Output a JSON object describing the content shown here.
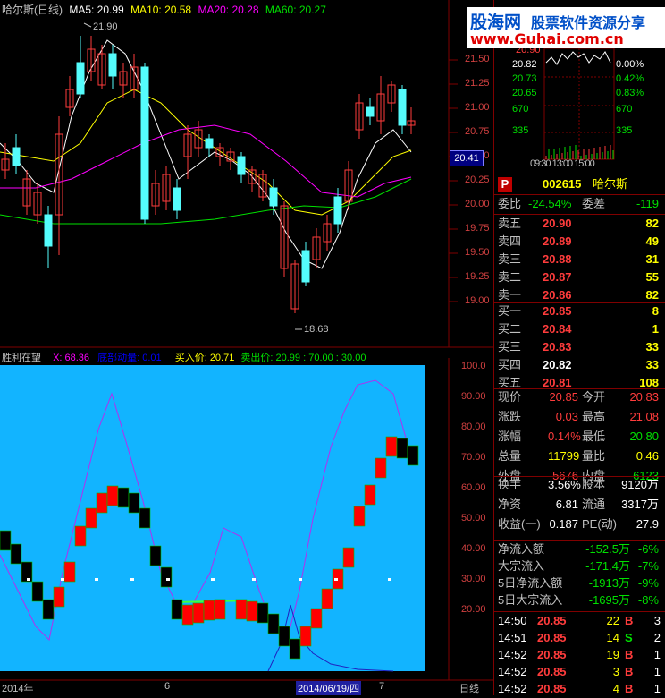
{
  "main_chart": {
    "title": "哈尔斯(日线)",
    "ma5": "MA5: 20.99",
    "ma10": "MA10: 20.58",
    "ma20": "MA20: 20.28",
    "ma60": "MA60: 20.27",
    "high_marker": "21.90",
    "low_marker": "18.68",
    "current_price_tag": "20.41",
    "price_ticks": [
      "21.50",
      "21.25",
      "21.00",
      "20.75",
      "20.50",
      "20.25",
      "20.00",
      "19.75",
      "19.50",
      "19.25",
      "19.00"
    ]
  },
  "indicator": {
    "name": "胜利在望",
    "x": "X: 68.36",
    "bottom_energy": "底部动量: 0.01",
    "buy_price": "买入价: 20.71",
    "sell_price": "卖出价: 20.99 : 70.00 : 30.00",
    "ticks": [
      "100.0",
      "90.00",
      "80.00",
      "70.00",
      "60.00",
      "50.00",
      "40.00",
      "30.00",
      "20.00"
    ]
  },
  "x_axis": {
    "start": "2014年",
    "month": "6",
    "cursor_date": "2014/06/19/四",
    "month2": "7",
    "period": "日线"
  },
  "watermark": {
    "site": "股海网",
    "slogan": "股票软件资源分享",
    "url": "www.Guhai.com.cn"
  },
  "mini_chart": {
    "left_vals": [
      "20.82",
      "20.73",
      "20.65",
      "670",
      "335"
    ],
    "right_vals": [
      "0.00%",
      "0.42%",
      "0.83%",
      "670",
      "335"
    ],
    "top_partial": "20.90",
    "time": "09:30 13:00 15:00"
  },
  "stock": {
    "code": "002615",
    "name": "哈尔斯",
    "p_badge": "P"
  },
  "commission": {
    "label_ratio": "委比",
    "ratio": "-24.54%",
    "label_diff": "委差",
    "diff": "-119"
  },
  "asks": [
    {
      "label": "卖五",
      "price": "20.90",
      "vol": "82"
    },
    {
      "label": "卖四",
      "price": "20.89",
      "vol": "49"
    },
    {
      "label": "卖三",
      "price": "20.88",
      "vol": "31"
    },
    {
      "label": "卖二",
      "price": "20.87",
      "vol": "55"
    },
    {
      "label": "卖一",
      "price": "20.86",
      "vol": "82"
    }
  ],
  "bids": [
    {
      "label": "买一",
      "price": "20.85",
      "vol": "8"
    },
    {
      "label": "买二",
      "price": "20.84",
      "vol": "1"
    },
    {
      "label": "买三",
      "price": "20.83",
      "vol": "33"
    },
    {
      "label": "买四",
      "price": "20.82",
      "vol": "33"
    },
    {
      "label": "买五",
      "price": "20.81",
      "vol": "108"
    }
  ],
  "quote": [
    {
      "l1": "现价",
      "v1": "20.85",
      "l2": "今开",
      "v2": "20.83"
    },
    {
      "l1": "涨跌",
      "v1": "0.03",
      "l2": "最高",
      "v2": "21.08"
    },
    {
      "l1": "涨幅",
      "v1": "0.14%",
      "l2": "最低",
      "v2": "20.80"
    },
    {
      "l1": "总量",
      "v1": "11799",
      "l2": "量比",
      "v2": "0.46"
    },
    {
      "l1": "外盘",
      "v1": "5676",
      "l2": "内盘",
      "v2": "6123"
    }
  ],
  "fundamentals": [
    {
      "l1": "换手",
      "v1": "3.56%",
      "l2": "股本",
      "v2": "9120万"
    },
    {
      "l1": "净资",
      "v1": "6.81",
      "l2": "流通",
      "v2": "3317万"
    },
    {
      "l1": "收益(一)",
      "v1": "0.187",
      "l2": "PE(动)",
      "v2": "27.9"
    }
  ],
  "flows": [
    {
      "label": "净流入额",
      "value": "-152.5万",
      "pct": "-6%"
    },
    {
      "label": "大宗流入",
      "value": "-171.4万",
      "pct": "-7%"
    },
    {
      "label": "5日净流入额",
      "value": "-1913万",
      "pct": "-9%"
    },
    {
      "label": "5日大宗流入",
      "value": "-1695万",
      "pct": "-8%"
    }
  ],
  "ticks": [
    {
      "time": "14:50",
      "price": "20.85",
      "vol": "22",
      "bs": "B",
      "n": "3"
    },
    {
      "time": "14:51",
      "price": "20.85",
      "vol": "14",
      "bs": "S",
      "n": "2"
    },
    {
      "time": "14:52",
      "price": "20.85",
      "vol": "19",
      "bs": "B",
      "n": "1"
    },
    {
      "time": "14:52",
      "price": "20.85",
      "vol": "3",
      "bs": "B",
      "n": "1"
    },
    {
      "time": "14:52",
      "price": "20.85",
      "vol": "4",
      "bs": "B",
      "n": "1"
    }
  ],
  "colors": {
    "up": "#ff3c3c",
    "down": "#54fcfc",
    "indicator_bg": "#12b4ff",
    "ma5": "#ffffff",
    "ma10": "#ffff00",
    "ma20": "#ff00ff",
    "ma60": "#00e000"
  }
}
